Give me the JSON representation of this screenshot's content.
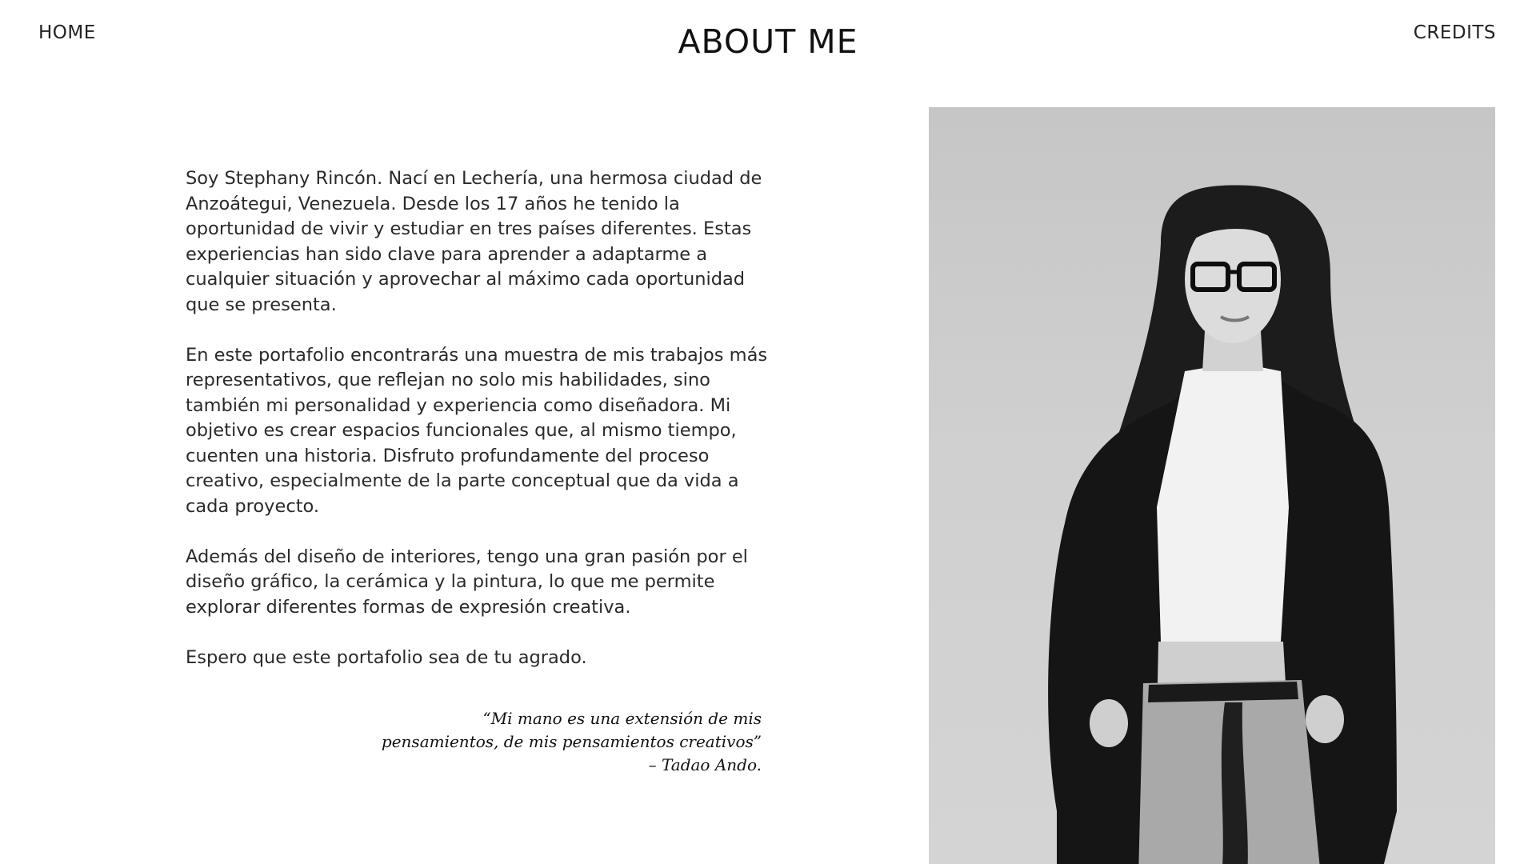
{
  "nav": {
    "home_label": "HOME",
    "credits_label": "CREDITS"
  },
  "page": {
    "title": "ABOUT ME"
  },
  "bio": {
    "paragraphs": [
      "Soy Stephany Rincón. Nací en Lechería, una hermosa ciudad de Anzoátegui, Venezuela. Desde los 17 años he tenido la oportunidad de vivir y estudiar en tres países diferentes. Estas experiencias han sido clave para aprender a adaptarme a cualquier situación y aprovechar al máximo cada oportunidad que se presenta.",
      "En este portafolio encontrarás una muestra de mis trabajos más representativos, que reflejan no solo mis habilidades, sino también mi personalidad y experiencia como diseñadora. Mi objetivo es crear espacios funcionales que, al mismo tiempo, cuenten una historia. Disfruto profundamente del proceso creativo, especialmente de la parte conceptual que da vida a cada proyecto.",
      "Además del diseño de interiores, tengo una gran pasión por el diseño gráfico, la cerámica y la pintura, lo que me permite explorar diferentes formas de expresión creativa.",
      "Espero que este portafolio sea de tu agrado."
    ]
  },
  "quote": {
    "line1": "“Mi mano es una extensión de mis",
    "line2": "pensamientos, de mis pensamientos creativos”",
    "line3": "– Tadao Ando."
  },
  "photo": {
    "icon": "portrait-photo",
    "background_color": "#cccccc"
  }
}
